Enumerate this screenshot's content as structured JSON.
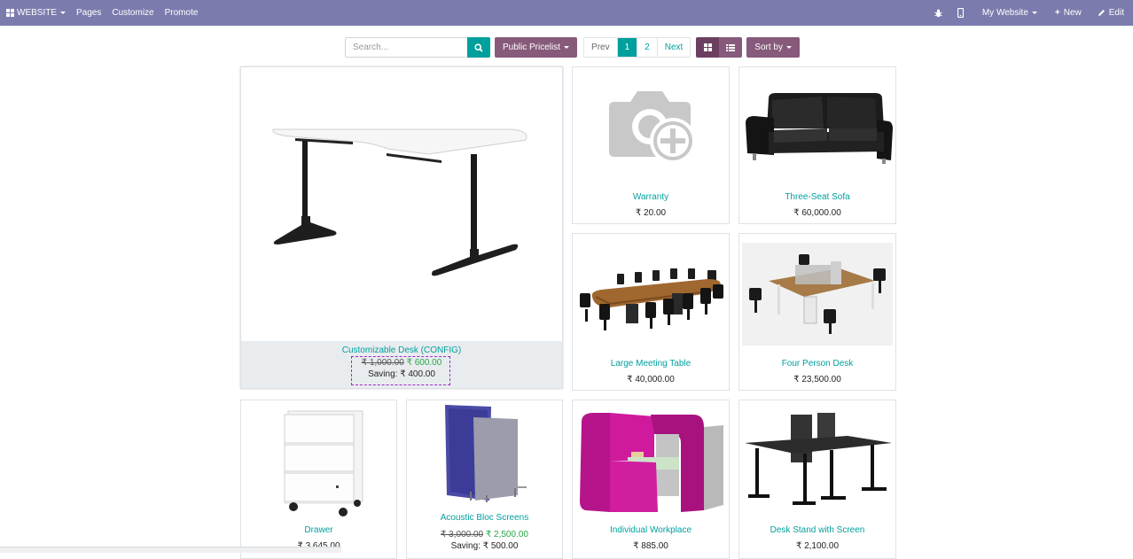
{
  "topbar": {
    "website_label": "WEBSITE",
    "pages_label": "Pages",
    "customize_label": "Customize",
    "promote_label": "Promote",
    "my_website_label": "My Website",
    "new_label": "New",
    "edit_label": "Edit",
    "bg_color": "#7c7bad"
  },
  "toolbar": {
    "search_placeholder": "Search...",
    "pricelist_label": "Public Pricelist",
    "pager": {
      "prev": "Prev",
      "pages": [
        "1",
        "2"
      ],
      "next": "Next",
      "active": "1"
    },
    "sort_label": "Sort by"
  },
  "products": [
    {
      "name": "Customizable Desk (CONFIG)",
      "old_price": "₹ 1,000.00",
      "price": "₹ 600.00",
      "saving": "Saving: ₹ 400.00",
      "image": "desk-image"
    },
    {
      "name": "Warranty",
      "price": "₹ 20.00",
      "image": "camera-placeholder-icon"
    },
    {
      "name": "Three-Seat Sofa",
      "price": "₹ 60,000.00",
      "image": "sofa-image"
    },
    {
      "name": "Large Meeting Table",
      "price": "₹ 40,000.00",
      "image": "meeting-table-image"
    },
    {
      "name": "Four Person Desk",
      "price": "₹ 23,500.00",
      "image": "four-person-desk-image"
    },
    {
      "name": "Drawer",
      "price": "₹ 3,645.00",
      "image": "drawer-image"
    },
    {
      "name": "Acoustic Bloc Screens",
      "old_price": "₹ 3,000.00",
      "price": "₹ 2,500.00",
      "saving": "Saving: ₹ 500.00",
      "image": "acoustic-screens-image"
    },
    {
      "name": "Individual Workplace",
      "price": "₹ 885.00",
      "image": "individual-workplace-image"
    },
    {
      "name": "Desk Stand with Screen",
      "price": "₹ 2,100.00",
      "image": "desk-stand-image"
    }
  ],
  "colors": {
    "accent": "#00a09d",
    "brand_purple": "#875a7b",
    "saving": "#f0ad00",
    "sale_price": "#28a745"
  }
}
